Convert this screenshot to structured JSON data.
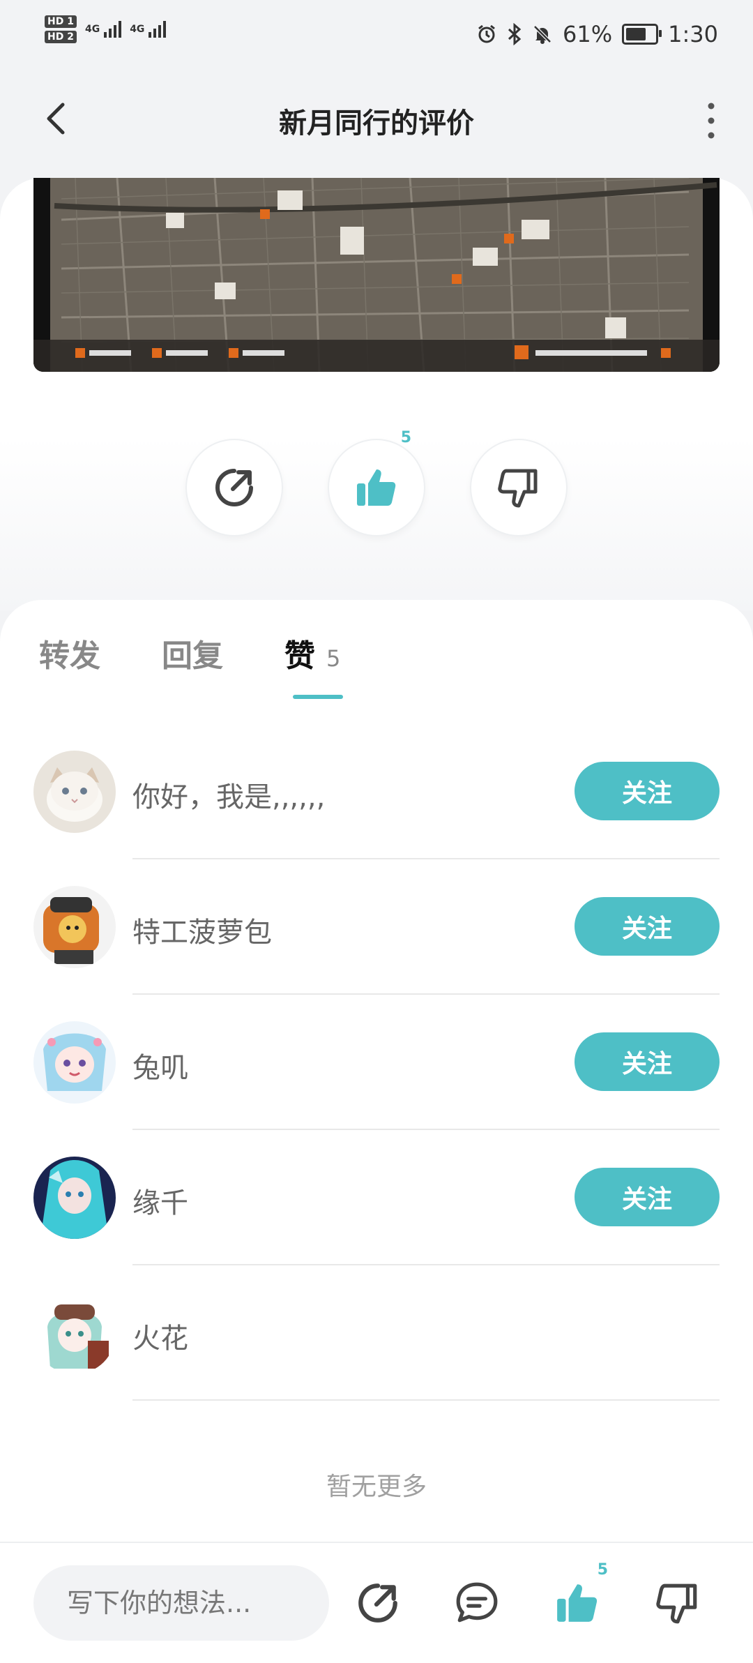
{
  "status_bar": {
    "sim1": "HD 1",
    "sim2": "HD 2",
    "net1": "4G",
    "net2": "4G",
    "battery": "61%",
    "time": "1:30"
  },
  "header": {
    "title": "新月同行的评价"
  },
  "actions": {
    "like_count": "5"
  },
  "tabs": [
    {
      "label": "转发"
    },
    {
      "label": "回复"
    },
    {
      "label": "赞",
      "count": "5"
    }
  ],
  "likers": [
    {
      "name": "你好，我是,,,,,,",
      "follow": "关注"
    },
    {
      "name": "特工菠萝包",
      "follow": "关注"
    },
    {
      "name": "兔叽",
      "follow": "关注"
    },
    {
      "name": "缘千",
      "follow": "关注"
    },
    {
      "name": "火花"
    }
  ],
  "footer_note": "暂无更多",
  "bottom_bar": {
    "placeholder": "写下你的想法...",
    "like_count": "5"
  },
  "colors": {
    "accent": "#4ebfc6",
    "background": "#f2f3f5"
  }
}
